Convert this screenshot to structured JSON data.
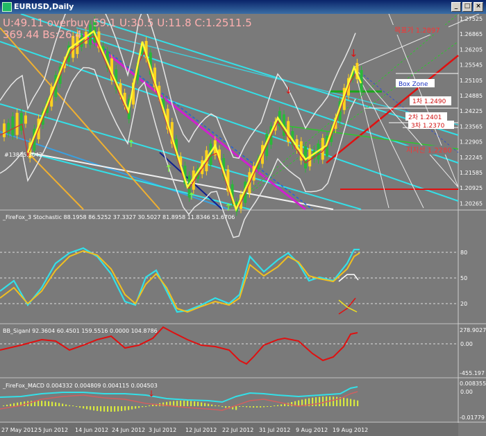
{
  "window": {
    "title": "EURUSD,Daily"
  },
  "header": {
    "line1": "U:49.11  overbuy  59.1 U:30.5  U:11.8  C:1.2511.5",
    "line2": "369.44  Bs:26.4"
  },
  "price_labels": [
    "1.27525",
    "1.26865",
    "1.26205",
    "1.25545",
    "1.25105",
    "1.24885",
    "1.24225",
    "1.23565",
    "1.22905",
    "1.22245",
    "1.21585",
    "1.20925",
    "1.20265"
  ],
  "chart_annotations": {
    "target": "목표가 1.2897",
    "box_zone": "Box Zone",
    "level1": "1차 1.2490",
    "level2": "2차 1.2401",
    "level3": "3차 1.2370",
    "support": "지지선 1.2280",
    "left_marker": "#13815.3042"
  },
  "stochastic": {
    "label": "_FireFox_3 Stochastic 88.1958 86.5252 37.3327 30.5027 81.8958 11.8346 51.6706",
    "levels": [
      "80",
      "50",
      "20"
    ]
  },
  "bb_signal": {
    "label": "BB_Siganl 92.3604 60.4501 159.5516 0.0000 104.8786",
    "levels": [
      "278.9027",
      "0.00",
      "-455.197"
    ]
  },
  "macd": {
    "label": "_FireFox_MACD 0.004332 0.004809 0.004115 0.004503",
    "levels": [
      "0.008355",
      "0.00",
      "-0.01779"
    ]
  },
  "date_labels": [
    "27 May 2012",
    "5 Jun 2012",
    "14 Jun 2012",
    "24 Jun 2012",
    "3 Jul 2012",
    "12 Jul 2012",
    "22 Jul 2012",
    "31 Jul 2012",
    "9 Aug 2012",
    "19 Aug 2012"
  ],
  "colors": {
    "background": "#7a7a7a",
    "candle_up": "#ffd21e",
    "candle_down": "#2ab83a",
    "zigzag": "#ffff33",
    "cyan": "#33e0e8",
    "red": "#e01010"
  }
}
